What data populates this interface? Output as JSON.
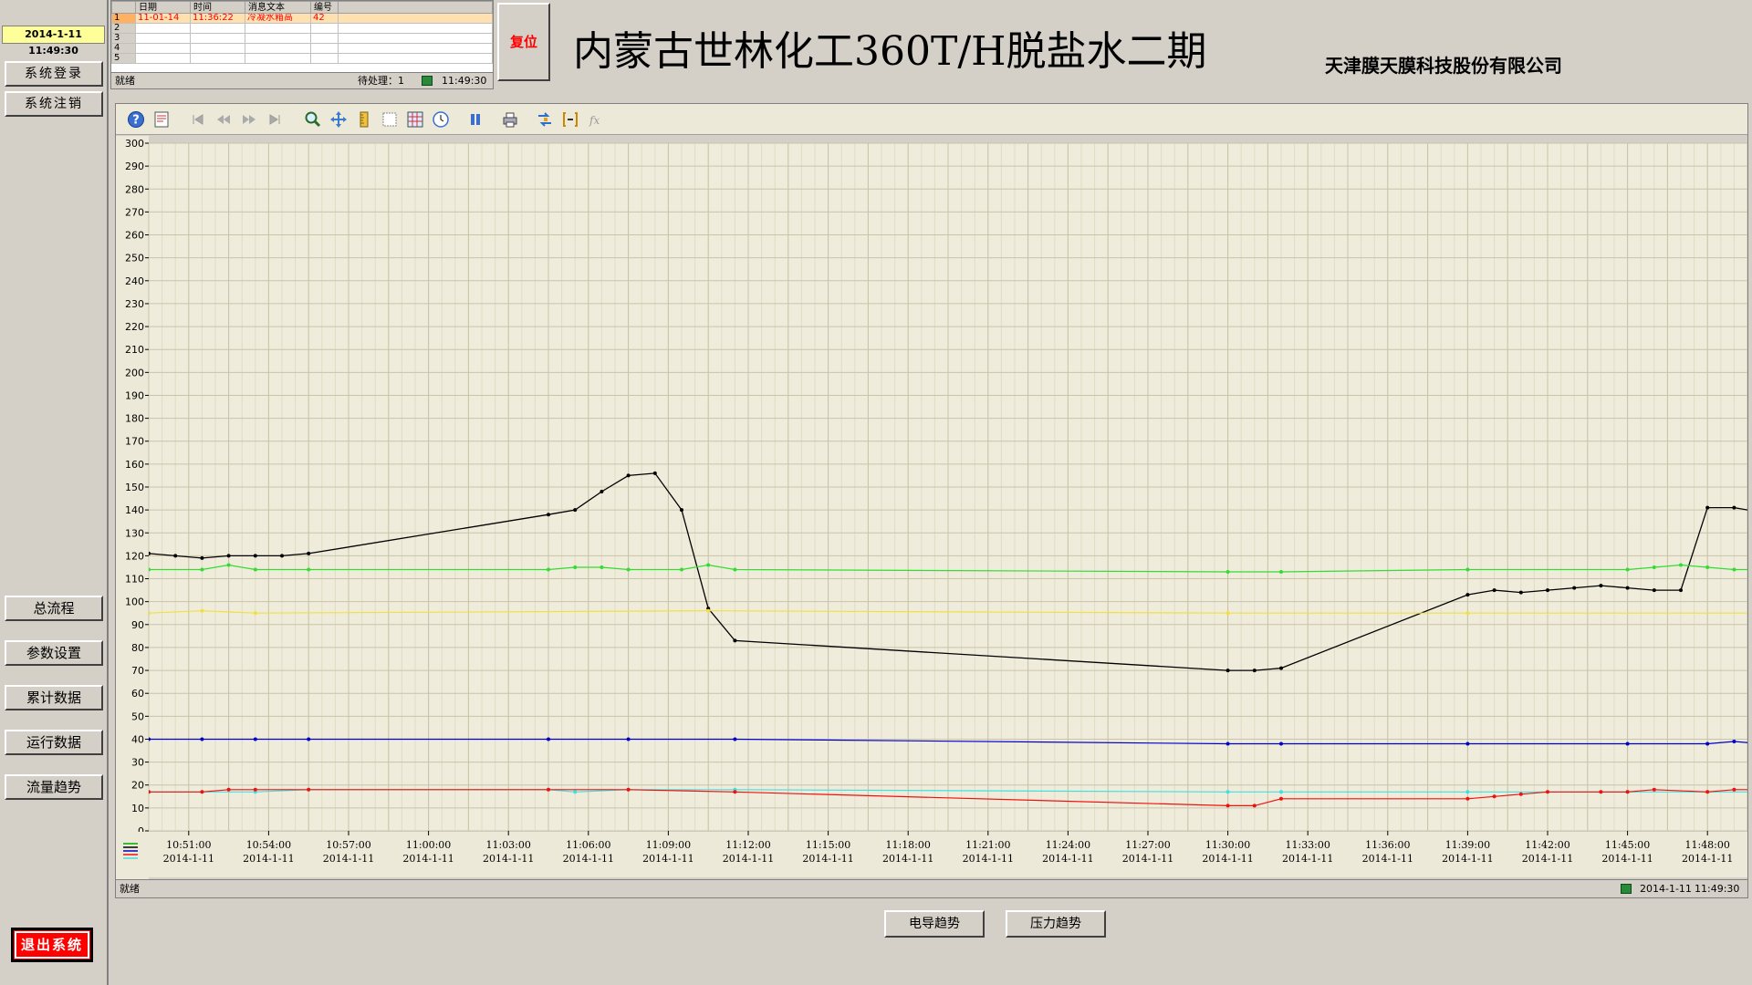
{
  "header": {
    "datetime": "2014-1-11 11:49:30",
    "title": "内蒙古世林化工360T/H脱盐水二期",
    "company": "天津膜天膜科技股份有限公司",
    "reset_label": "复位"
  },
  "alarm": {
    "columns": [
      "日期",
      "时间",
      "消息文本",
      "编号"
    ],
    "rows": [
      {
        "idx": "1",
        "date": "11-01-14",
        "time": "11:36:22",
        "text": "冷凝水箱高",
        "code": "42"
      },
      {
        "idx": "2",
        "date": "",
        "time": "",
        "text": "",
        "code": ""
      },
      {
        "idx": "3",
        "date": "",
        "time": "",
        "text": "",
        "code": ""
      },
      {
        "idx": "4",
        "date": "",
        "time": "",
        "text": "",
        "code": ""
      },
      {
        "idx": "5",
        "date": "",
        "time": "",
        "text": "",
        "code": ""
      }
    ],
    "status_ready": "就绪",
    "pending": "待处理：1",
    "status_time": "11:49:30"
  },
  "sidebar": {
    "login": "系统登录",
    "logout": "系统注销",
    "nav": [
      "总流程",
      "参数设置",
      "累计数据",
      "运行数据",
      "流量趋势"
    ],
    "exit": "退出系统"
  },
  "trend_status": {
    "ready": "就绪",
    "date": "2014-1-11",
    "time": "11:49:30"
  },
  "bottom_buttons": {
    "conductivity": "电导趋势",
    "pressure": "压力趋势"
  },
  "icons": {
    "help": "help-icon",
    "edit": "edit-icon",
    "first": "first-icon",
    "prev": "prev-icon",
    "next": "next-icon",
    "last": "last-icon",
    "zoom": "zoom-icon",
    "move": "move-icon",
    "ruler": "ruler-icon",
    "select": "select-area-icon",
    "grid": "grid-icon",
    "clock": "clock-icon",
    "pause": "pause-icon",
    "print": "print-icon",
    "export": "export-icon",
    "bracket": "bracket-icon",
    "fx": "fx-icon",
    "legend": "legend-icon"
  },
  "colors": {
    "chart_bg": "#f0ecdc",
    "grid": "#c8c4a8",
    "black_series": "#000000",
    "green_series": "#30dd30",
    "yellow_series": "#f0e040",
    "blue_series": "#0000cc",
    "cyan_series": "#40e0e0",
    "red_series": "#ee1111",
    "alarm_text": "#ff0000"
  },
  "chart_data": {
    "type": "line",
    "ylim": [
      0,
      300
    ],
    "ytick_step": 10,
    "x_labels": [
      {
        "time": "10:51:00",
        "date": "2014-1-11"
      },
      {
        "time": "10:54:00",
        "date": "2014-1-11"
      },
      {
        "time": "10:57:00",
        "date": "2014-1-11"
      },
      {
        "time": "11:00:00",
        "date": "2014-1-11"
      },
      {
        "time": "11:03:00",
        "date": "2014-1-11"
      },
      {
        "time": "11:06:00",
        "date": "2014-1-11"
      },
      {
        "time": "11:09:00",
        "date": "2014-1-11"
      },
      {
        "time": "11:12:00",
        "date": "2014-1-11"
      },
      {
        "time": "11:15:00",
        "date": "2014-1-11"
      },
      {
        "time": "11:18:00",
        "date": "2014-1-11"
      },
      {
        "time": "11:21:00",
        "date": "2014-1-11"
      },
      {
        "time": "11:24:00",
        "date": "2014-1-11"
      },
      {
        "time": "11:27:00",
        "date": "2014-1-11"
      },
      {
        "time": "11:30:00",
        "date": "2014-1-11"
      },
      {
        "time": "11:33:00",
        "date": "2014-1-11"
      },
      {
        "time": "11:36:00",
        "date": "2014-1-11"
      },
      {
        "time": "11:39:00",
        "date": "2014-1-11"
      },
      {
        "time": "11:42:00",
        "date": "2014-1-11"
      },
      {
        "time": "11:45:00",
        "date": "2014-1-11"
      },
      {
        "time": "11:48:00",
        "date": "2014-1-11"
      }
    ],
    "x_range": [
      "10:49:30",
      "11:49:30"
    ],
    "series": [
      {
        "color": "#000000",
        "points": [
          [
            "10:49:30",
            121
          ],
          [
            "10:50:30",
            120
          ],
          [
            "10:51:30",
            119
          ],
          [
            "10:52:30",
            120
          ],
          [
            "10:53:30",
            120
          ],
          [
            "10:54:30",
            120
          ],
          [
            "10:55:30",
            121
          ],
          [
            "11:04:30",
            138
          ],
          [
            "11:05:30",
            140
          ],
          [
            "11:06:30",
            148
          ],
          [
            "11:07:30",
            155
          ],
          [
            "11:08:30",
            156
          ],
          [
            "11:09:30",
            140
          ],
          [
            "11:10:30",
            97
          ],
          [
            "11:11:30",
            83
          ],
          [
            "11:30:00",
            70
          ],
          [
            "11:31:00",
            70
          ],
          [
            "11:32:00",
            71
          ],
          [
            "11:39:00",
            103
          ],
          [
            "11:40:00",
            105
          ],
          [
            "11:41:00",
            104
          ],
          [
            "11:42:00",
            105
          ],
          [
            "11:43:00",
            106
          ],
          [
            "11:44:00",
            107
          ],
          [
            "11:45:00",
            106
          ],
          [
            "11:46:00",
            105
          ],
          [
            "11:47:00",
            105
          ],
          [
            "11:48:00",
            141
          ],
          [
            "11:49:00",
            141
          ],
          [
            "11:50:00",
            139
          ],
          [
            "11:51:00",
            143
          ]
        ]
      },
      {
        "color": "#30dd30",
        "points": [
          [
            "10:49:30",
            114
          ],
          [
            "10:51:30",
            114
          ],
          [
            "10:52:30",
            116
          ],
          [
            "10:53:30",
            114
          ],
          [
            "10:55:30",
            114
          ],
          [
            "11:04:30",
            114
          ],
          [
            "11:05:30",
            115
          ],
          [
            "11:06:30",
            115
          ],
          [
            "11:07:30",
            114
          ],
          [
            "11:09:30",
            114
          ],
          [
            "11:10:30",
            116
          ],
          [
            "11:11:30",
            114
          ],
          [
            "11:30:00",
            113
          ],
          [
            "11:32:00",
            113
          ],
          [
            "11:39:00",
            114
          ],
          [
            "11:45:00",
            114
          ],
          [
            "11:46:00",
            115
          ],
          [
            "11:47:00",
            116
          ],
          [
            "11:48:00",
            115
          ],
          [
            "11:49:00",
            114
          ],
          [
            "11:51:00",
            114
          ]
        ]
      },
      {
        "color": "#f0e040",
        "points": [
          [
            "10:49:30",
            95
          ],
          [
            "10:51:30",
            96
          ],
          [
            "10:53:30",
            95
          ],
          [
            "11:10:30",
            96
          ],
          [
            "11:30:00",
            95
          ],
          [
            "11:39:00",
            95
          ],
          [
            "11:51:00",
            95
          ]
        ]
      },
      {
        "color": "#0000cc",
        "points": [
          [
            "10:49:30",
            40
          ],
          [
            "10:51:30",
            40
          ],
          [
            "10:53:30",
            40
          ],
          [
            "10:55:30",
            40
          ],
          [
            "11:04:30",
            40
          ],
          [
            "11:07:30",
            40
          ],
          [
            "11:11:30",
            40
          ],
          [
            "11:30:00",
            38
          ],
          [
            "11:32:00",
            38
          ],
          [
            "11:39:00",
            38
          ],
          [
            "11:45:00",
            38
          ],
          [
            "11:48:00",
            38
          ],
          [
            "11:49:00",
            39
          ],
          [
            "11:50:00",
            38
          ],
          [
            "11:51:00",
            38
          ]
        ]
      },
      {
        "color": "#40e0e0",
        "points": [
          [
            "10:49:30",
            17
          ],
          [
            "10:51:30",
            17
          ],
          [
            "10:53:30",
            17
          ],
          [
            "10:55:30",
            18
          ],
          [
            "11:04:30",
            18
          ],
          [
            "11:05:30",
            17
          ],
          [
            "11:07:30",
            18
          ],
          [
            "11:11:30",
            18
          ],
          [
            "11:30:00",
            17
          ],
          [
            "11:32:00",
            17
          ],
          [
            "11:39:00",
            17
          ],
          [
            "11:45:00",
            17
          ],
          [
            "11:51:00",
            17
          ]
        ]
      },
      {
        "color": "#ee1111",
        "points": [
          [
            "10:49:30",
            17
          ],
          [
            "10:51:30",
            17
          ],
          [
            "10:52:30",
            18
          ],
          [
            "10:53:30",
            18
          ],
          [
            "10:55:30",
            18
          ],
          [
            "11:04:30",
            18
          ],
          [
            "11:07:30",
            18
          ],
          [
            "11:11:30",
            17
          ],
          [
            "11:30:00",
            11
          ],
          [
            "11:31:00",
            11
          ],
          [
            "11:32:00",
            14
          ],
          [
            "11:39:00",
            14
          ],
          [
            "11:40:00",
            15
          ],
          [
            "11:41:00",
            16
          ],
          [
            "11:42:00",
            17
          ],
          [
            "11:44:00",
            17
          ],
          [
            "11:45:00",
            17
          ],
          [
            "11:46:00",
            18
          ],
          [
            "11:48:00",
            17
          ],
          [
            "11:49:00",
            18
          ],
          [
            "11:51:00",
            18
          ]
        ]
      }
    ]
  }
}
